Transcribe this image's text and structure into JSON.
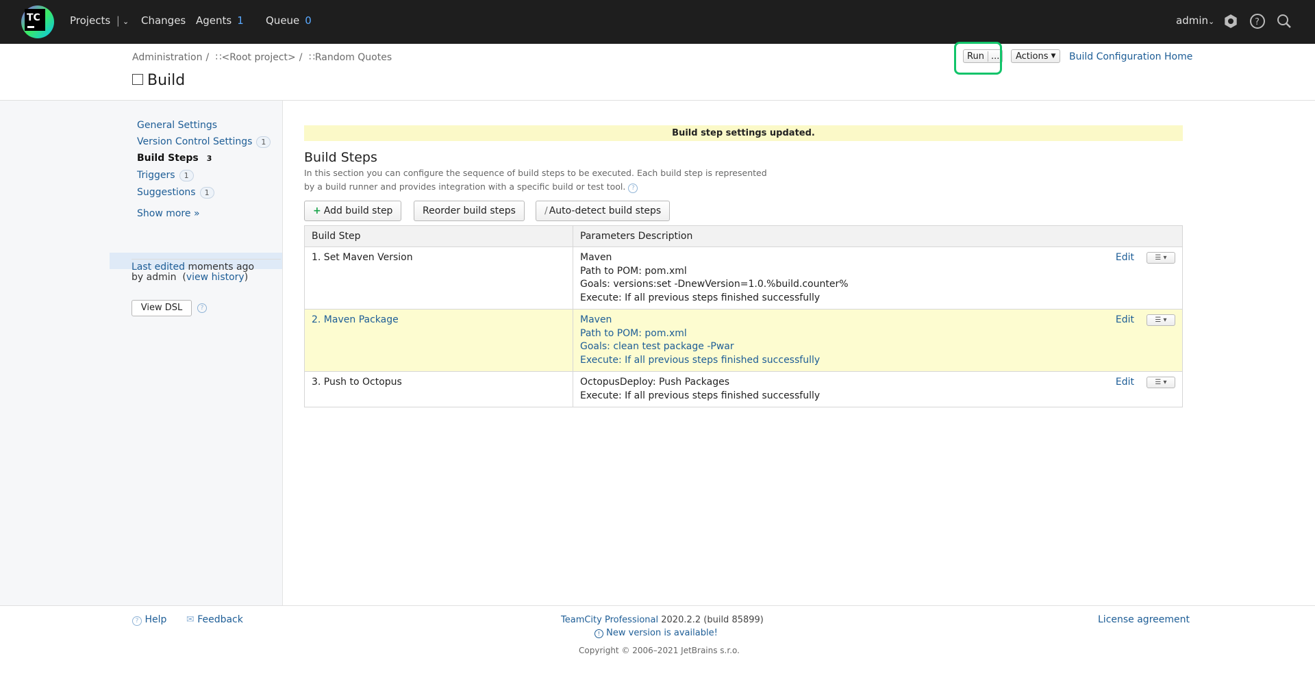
{
  "topnav": {
    "logo_text": "TC",
    "projects": "Projects",
    "changes": "Changes",
    "agents": "Agents",
    "agents_count": "1",
    "queue": "Queue",
    "queue_count": "0",
    "user": "admin"
  },
  "header": {
    "breadcrumb": [
      "Administration",
      "<Root project>",
      "Random Quotes"
    ],
    "title": "Build",
    "run": "Run",
    "run_more": "...",
    "actions": "Actions",
    "config_home": "Build Configuration Home"
  },
  "sidebar": {
    "items": [
      {
        "label": "General Settings",
        "badge": ""
      },
      {
        "label": "Version Control Settings",
        "badge": "1"
      },
      {
        "label": "Build Steps",
        "badge": "3"
      },
      {
        "label": "Triggers",
        "badge": "1"
      },
      {
        "label": "Suggestions",
        "badge": "1"
      }
    ],
    "show_more": "Show more »",
    "last_edited_link": "Last edited",
    "last_edited_text": "moments ago",
    "by": "by admin",
    "view_history": "view history",
    "view_dsl": "View DSL"
  },
  "main": {
    "notice": "Build step settings updated.",
    "title": "Build Steps",
    "description": "In this section you can configure the sequence of build steps to be executed. Each build step is represented by a build runner and provides integration with a specific build or test tool.",
    "buttons": {
      "add": "Add build step",
      "reorder": "Reorder build steps",
      "autodetect": "Auto-detect build steps"
    },
    "columns": [
      "Build Step",
      "Parameters Description"
    ],
    "steps": [
      {
        "name": "1. Set Maven Version",
        "params": [
          "Maven",
          "Path to POM: pom.xml",
          "Goals: versions:set -DnewVersion=1.0.%build.counter%",
          "Execute: If all previous steps finished successfully"
        ],
        "edit": "Edit"
      },
      {
        "name": "2. Maven Package",
        "params": [
          "Maven",
          "Path to POM: pom.xml",
          "Goals: clean test package -Pwar",
          "Execute: If all previous steps finished successfully"
        ],
        "edit": "Edit"
      },
      {
        "name": "3. Push to Octopus",
        "params": [
          "OctopusDeploy: Push Packages",
          "Execute: If all previous steps finished successfully"
        ],
        "edit": "Edit"
      }
    ]
  },
  "footer": {
    "help": "Help",
    "feedback": "Feedback",
    "product": "TeamCity Professional",
    "version": "2020.2.2 (build 85899)",
    "new_version": "New version is available!",
    "copyright": "Copyright © 2006–2021 JetBrains s.r.o.",
    "license": "License agreement"
  }
}
